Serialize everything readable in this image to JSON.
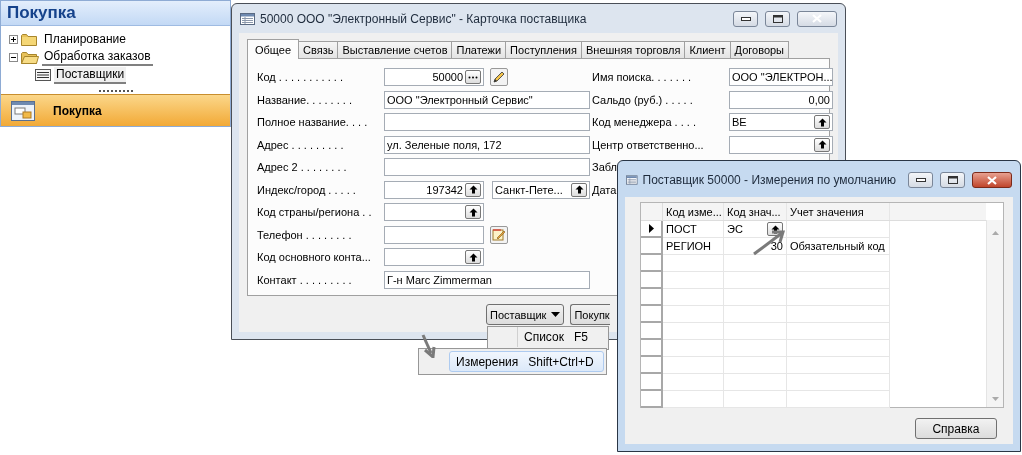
{
  "nav": {
    "title": "Покупка",
    "tree": [
      {
        "label": "Планирование",
        "expanded": false,
        "selected": false
      },
      {
        "label": "Обработка заказов",
        "expanded": true,
        "selected": false,
        "children": [
          {
            "label": "Поставщики",
            "selected": true
          }
        ]
      }
    ],
    "button": {
      "label": "Покупка"
    }
  },
  "card_window": {
    "title": "50000 ООО \"Электронный Сервис\" - Карточка поставщика",
    "tabs": [
      {
        "label": "Общее",
        "selected": true
      },
      {
        "label": "Связь",
        "selected": false
      },
      {
        "label": "Выставление счетов",
        "selected": false
      },
      {
        "label": "Платежи",
        "selected": false
      },
      {
        "label": "Поступления",
        "selected": false
      },
      {
        "label": "Внешняя торговля",
        "selected": false
      },
      {
        "label": "Клиент",
        "selected": false
      },
      {
        "label": "Договоры",
        "selected": false
      }
    ],
    "left_fields": [
      {
        "label": "Код . . . . . . . . . . .",
        "inputs": [
          {
            "kind": "code",
            "value": "50000",
            "numeric": true,
            "assist": true
          }
        ],
        "edit_button": true
      },
      {
        "label": "Название. . . . . . . .",
        "inputs": [
          {
            "kind": "text",
            "value": "ООО \"Электронный Сервис\""
          }
        ]
      },
      {
        "label": "Полное название. . . .",
        "inputs": [
          {
            "kind": "text"
          }
        ]
      },
      {
        "label": "Адрес . . . . . . . . .",
        "inputs": [
          {
            "kind": "text",
            "value": "ул. Зеленые поля, 172"
          }
        ]
      },
      {
        "label": "Адрес 2 . . . . . . . .",
        "inputs": [
          {
            "kind": "text"
          }
        ]
      },
      {
        "label": "Индекс/город . . . . .",
        "inputs": [
          {
            "kind": "code",
            "value": "197342",
            "numeric": true,
            "lookup": true
          },
          {
            "kind": "city",
            "value": "Санкт-Пете...",
            "lookup": true
          }
        ]
      },
      {
        "label": "Код страны/региона . .",
        "inputs": [
          {
            "kind": "code",
            "lookup": true
          }
        ]
      },
      {
        "label": "Телефон . . . . . . . .",
        "inputs": [
          {
            "kind": "code"
          }
        ],
        "notepad_button": true
      },
      {
        "label": "Код основного конта...",
        "inputs": [
          {
            "kind": "code",
            "lookup": true
          }
        ]
      },
      {
        "label": "Контакт . . . . . . . . .",
        "inputs": [
          {
            "kind": "text",
            "value": "Г-н Marc Zimmerman"
          }
        ]
      }
    ],
    "right_fields": [
      {
        "label": "Имя поиска. . . . . . .",
        "inputs": [
          {
            "kind": "side",
            "value": "ООО \"ЭЛЕКТРОН..."
          }
        ]
      },
      {
        "label": "Сальдо (руб.) . . . . .",
        "inputs": [
          {
            "kind": "side",
            "value": "0,00",
            "numeric": true
          }
        ]
      },
      {
        "label": "Код менеджера . . . .",
        "inputs": [
          {
            "kind": "side",
            "value": "ВЕ",
            "lookup": true
          }
        ]
      },
      {
        "label": "Центр ответственно...",
        "inputs": [
          {
            "kind": "side",
            "lookup": true
          }
        ]
      },
      {
        "label": "Забл"
      },
      {
        "label": "Дата"
      }
    ],
    "buttons": [
      {
        "label": "Поставщик",
        "dropdown": true
      },
      {
        "label": "Покупк",
        "dropdown": false
      }
    ]
  },
  "menu": [
    {
      "label": "Список",
      "shortcut": "F5",
      "highlighted": false
    },
    {
      "label": "Измерения",
      "shortcut": "Shift+Ctrl+D",
      "highlighted": true
    }
  ],
  "dimension_window": {
    "title": "Поставщик 50000 - Измерения по умолчанию",
    "columns": [
      "Код изме...",
      "Код знач...",
      "Учет значения"
    ],
    "rows": [
      {
        "current": true,
        "cells": [
          {
            "text": "ПОСТ"
          },
          {
            "text": "ЭС",
            "lookup": true
          }
        ]
      },
      {
        "current": false,
        "cells": [
          {
            "text": "РЕГИОН"
          },
          {
            "text": "30",
            "numeric": true
          },
          {
            "text": "Обязательный код"
          }
        ]
      }
    ],
    "button": "Справка"
  }
}
